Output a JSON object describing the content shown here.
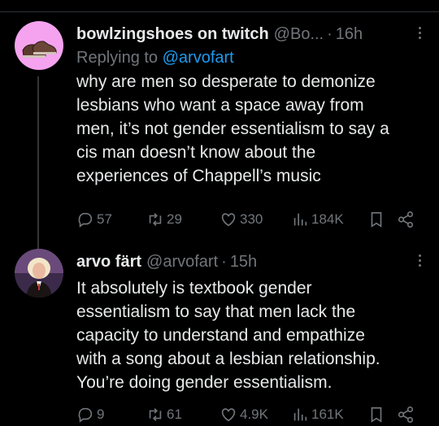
{
  "tweets": [
    {
      "display_name": "bowlzingshoes on twitch",
      "handle": "@Bo...",
      "dot": "·",
      "time": "16h",
      "replying_prefix": "Replying to",
      "replying_to": "@arvofart",
      "text_lines": [
        "why are men so desperate to demonize",
        "lesbians who want a space away from",
        "men, it’s not gender essentialism to say a",
        "cis man doesn’t know about the",
        "experiences of Chappell’s music"
      ],
      "stats": {
        "replies": "57",
        "retweets": "29",
        "likes": "330",
        "views": "184K"
      }
    },
    {
      "display_name": "arvo färt",
      "handle": "@arvofart",
      "dot": "·",
      "time": "15h",
      "text_lines": [
        "It absolutely is textbook gender",
        "essentialism to say that men lack the",
        "capacity to understand and empathize",
        "with a song about a lesbian relationship.",
        "You’re doing gender essentialism."
      ],
      "stats": {
        "replies": "9",
        "retweets": "61",
        "likes": "4.9K",
        "views": "161K"
      }
    }
  ],
  "colors": {
    "background": "#000000",
    "text": "#e7e9ea",
    "muted": "#71767b",
    "link": "#1d9bf0",
    "avatar1_bg": "#f5a3ef"
  },
  "icons": [
    "reply-icon",
    "retweet-icon",
    "like-icon",
    "views-icon",
    "bookmark-icon",
    "share-icon",
    "more-icon"
  ]
}
